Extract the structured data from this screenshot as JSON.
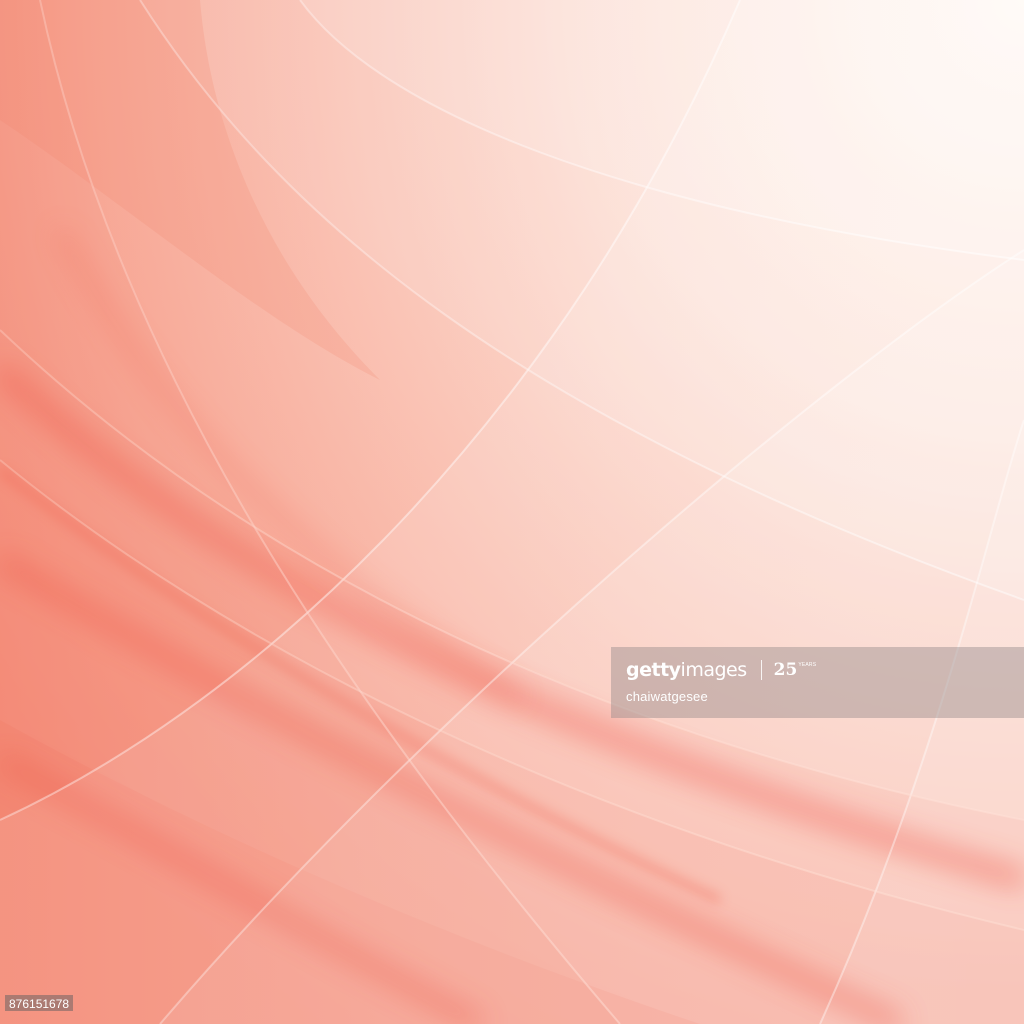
{
  "image": {
    "description_colors": {
      "base": "#fbd9cf",
      "highlight": "#fff6ee",
      "accent": "#f25a4a",
      "deep": "#ee4a3a"
    }
  },
  "watermark": {
    "brand_bold": "getty",
    "brand_light": "images",
    "anniversary_number": "25",
    "anniversary_label": "YEARS",
    "author": "chaiwatgesee"
  },
  "footer": {
    "image_id": "876151678"
  }
}
